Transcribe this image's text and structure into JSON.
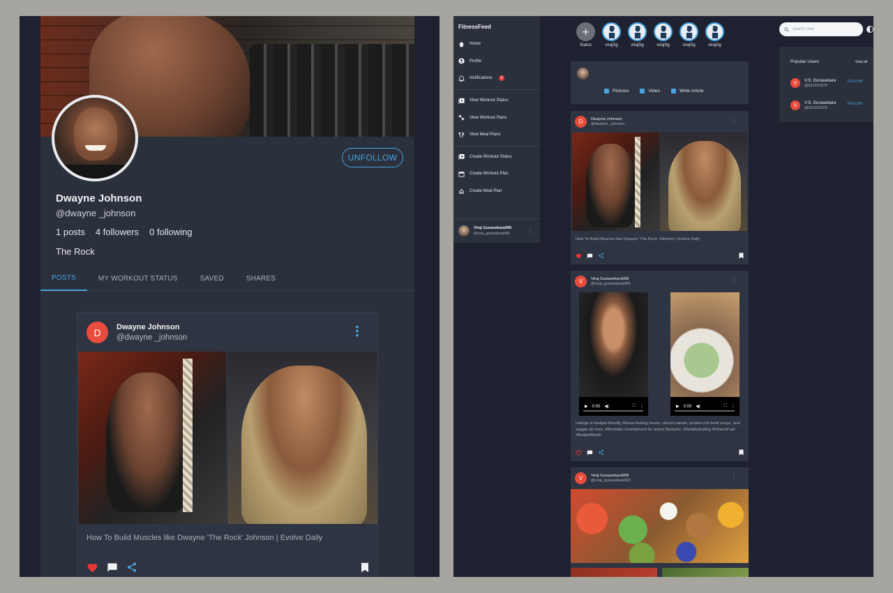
{
  "profile": {
    "name": "Dwayne Johnson",
    "handle": "@dwayne _johnson",
    "posts": "1 posts",
    "followers": "4 followers",
    "following": "0 following",
    "bio": "The Rock",
    "unfollow_label": "UNFOLLOW",
    "tabs": [
      "POSTS",
      "MY WORKOUT STATUS",
      "SAVED",
      "SHARES"
    ],
    "active_tab": "POSTS"
  },
  "profile_post": {
    "avatar_letter": "D",
    "author": "Dwayne Johnson",
    "handle": "@dwayne _johnson",
    "caption": "How To Build Muscles like Dwayne 'The Rock' Johnson | Evolve Daily"
  },
  "app": {
    "brand": "FitnessFeed",
    "nav_main": [
      {
        "label": "Home",
        "icon": "home-icon"
      },
      {
        "label": "Profile",
        "icon": "profile-icon"
      },
      {
        "label": "Notifications",
        "icon": "bell-icon",
        "badge": "0"
      }
    ],
    "nav_view": [
      {
        "label": "View Workout Status",
        "icon": "video-library-icon"
      },
      {
        "label": "View Workout Plans",
        "icon": "dumbbell-icon"
      },
      {
        "label": "View Meal Plans",
        "icon": "fork-knife-icon"
      }
    ],
    "nav_create": [
      {
        "label": "Create Workout Status",
        "icon": "add-library-icon"
      },
      {
        "label": "Create Workout Plan",
        "icon": "calendar-icon"
      },
      {
        "label": "Create Meal Plan",
        "icon": "meal-icon"
      }
    ],
    "current_user": {
      "name": "Viraj Gunasekara999",
      "handle": "@viraj_gunasekara999"
    },
    "stories": [
      {
        "label": "Status",
        "type": "add"
      },
      {
        "label": "virajSg",
        "type": "person"
      },
      {
        "label": "virajSg",
        "type": "person"
      },
      {
        "label": "virajSg",
        "type": "person"
      },
      {
        "label": "virajSg",
        "type": "person"
      },
      {
        "label": "virajSg",
        "type": "person"
      }
    ],
    "composer": {
      "pictures": "Pictures",
      "video": "Video",
      "article": "Write Article"
    },
    "search_placeholder": "search user",
    "popular": {
      "title": "Popular Users",
      "view_all": "View all",
      "users": [
        {
          "letter": "V",
          "name": "V.S. Gunasekara",
          "handle": "@it21320378",
          "follow": "FOLLOW"
        },
        {
          "letter": "V",
          "name": "V.S. Gunasekara",
          "handle": "@it21320378",
          "follow": "FOLLOW"
        }
      ]
    }
  },
  "feed": [
    {
      "letter": "D",
      "author": "Dwayne Johnson",
      "handle": "@dwayne _johnson",
      "caption": "How To Build Muscles like Dwayne 'The Rock' Johnson | Evolve Daily",
      "liked": true
    },
    {
      "letter": "V",
      "author": "Viraj Gunasekara999",
      "handle": "@viraj_gunasekara999",
      "caption": "Indulge in budget-friendly, fitness-fueling meals: vibrant salads, protein-rich lentil soups, and veggie stir-fries. Affordable nourishment for active lifestyles. #HealthyEating #FitnessFuel #BudgetMeals",
      "video_time": "0:00",
      "liked": false
    },
    {
      "letter": "V",
      "author": "Viraj Gunasekara999",
      "handle": "@viraj_gunasekara999"
    }
  ],
  "colors": {
    "accent": "#4aa3df",
    "like": "#e53935",
    "avatar": "#e74c3c",
    "card": "#2f3442",
    "background": "#1e2230"
  }
}
